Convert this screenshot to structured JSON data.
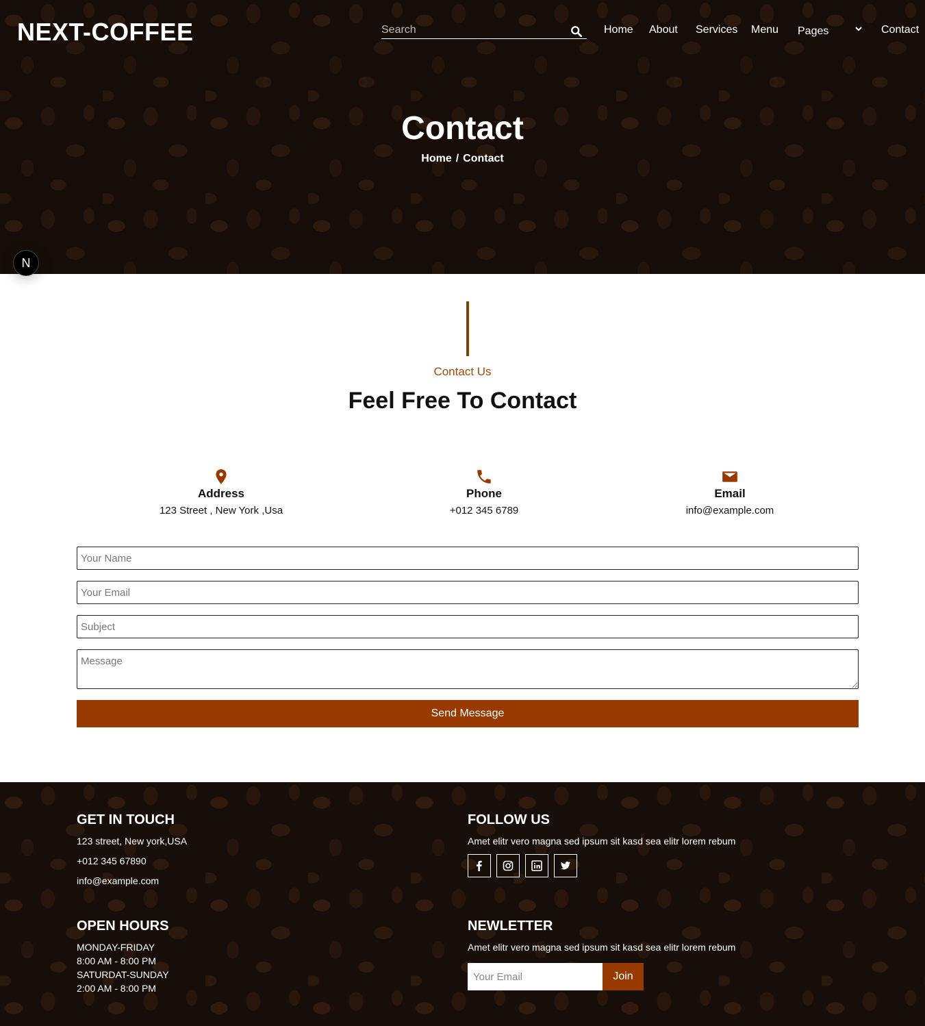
{
  "header": {
    "logo": "NEXT-COFFEE",
    "search_placeholder": "Search",
    "nav": [
      {
        "label": "Home"
      },
      {
        "label": "About"
      },
      {
        "label": "Services"
      },
      {
        "label": "Menu"
      },
      {
        "label": "Pages"
      },
      {
        "label": "Contact"
      }
    ]
  },
  "hero": {
    "title": "Contact",
    "breadcrumb": {
      "home": "Home",
      "separator": "/",
      "current": "Contact"
    },
    "badge": "N"
  },
  "contact": {
    "subtitle": "Contact Us",
    "title": "Feel Free To Contact",
    "info": [
      {
        "icon": "map-pin-icon",
        "label": "Address",
        "value": "123 Street , New York ,Usa"
      },
      {
        "icon": "phone-icon",
        "label": "Phone",
        "value": "+012 345 6789"
      },
      {
        "icon": "envelope-icon",
        "label": "Email",
        "value": "info@example.com"
      }
    ],
    "form": {
      "name_placeholder": "Your Name",
      "email_placeholder": "Your Email",
      "subject_placeholder": "Subject",
      "message_placeholder": "Message",
      "submit_label": "Send Message"
    }
  },
  "footer": {
    "get_in_touch": {
      "title": "GET IN TOUCH",
      "address": "123 street, New york,USA",
      "phone": "+012 345 67890",
      "email": "info@example.com"
    },
    "follow_us": {
      "title": "FOLLOW US",
      "text": "Amet elitr vero magna sed ipsum sit kasd sea elitr lorem rebum",
      "icons": [
        "facebook-icon",
        "instagram-icon",
        "linkedin-icon",
        "twitter-icon"
      ]
    },
    "open_hours": {
      "title": "OPEN HOURS",
      "weekday_label": "MONDAY-FRIDAY",
      "weekday_hours": "8:00 AM - 8:00 PM",
      "weekend_label": "SATURDAT-SUNDAY",
      "weekend_hours": "2:00 AM - 8:00 PM"
    },
    "newsletter": {
      "title": "NEWLETTER",
      "text": "Amet elitr vero magna sed ipsum sit kasd sea elitr lorem rebum",
      "placeholder": "Your Email",
      "button": "Join"
    }
  },
  "colors": {
    "accent": "#983a00",
    "accent_text": "#9a4a0a",
    "dark_bg": "#1e120c"
  }
}
